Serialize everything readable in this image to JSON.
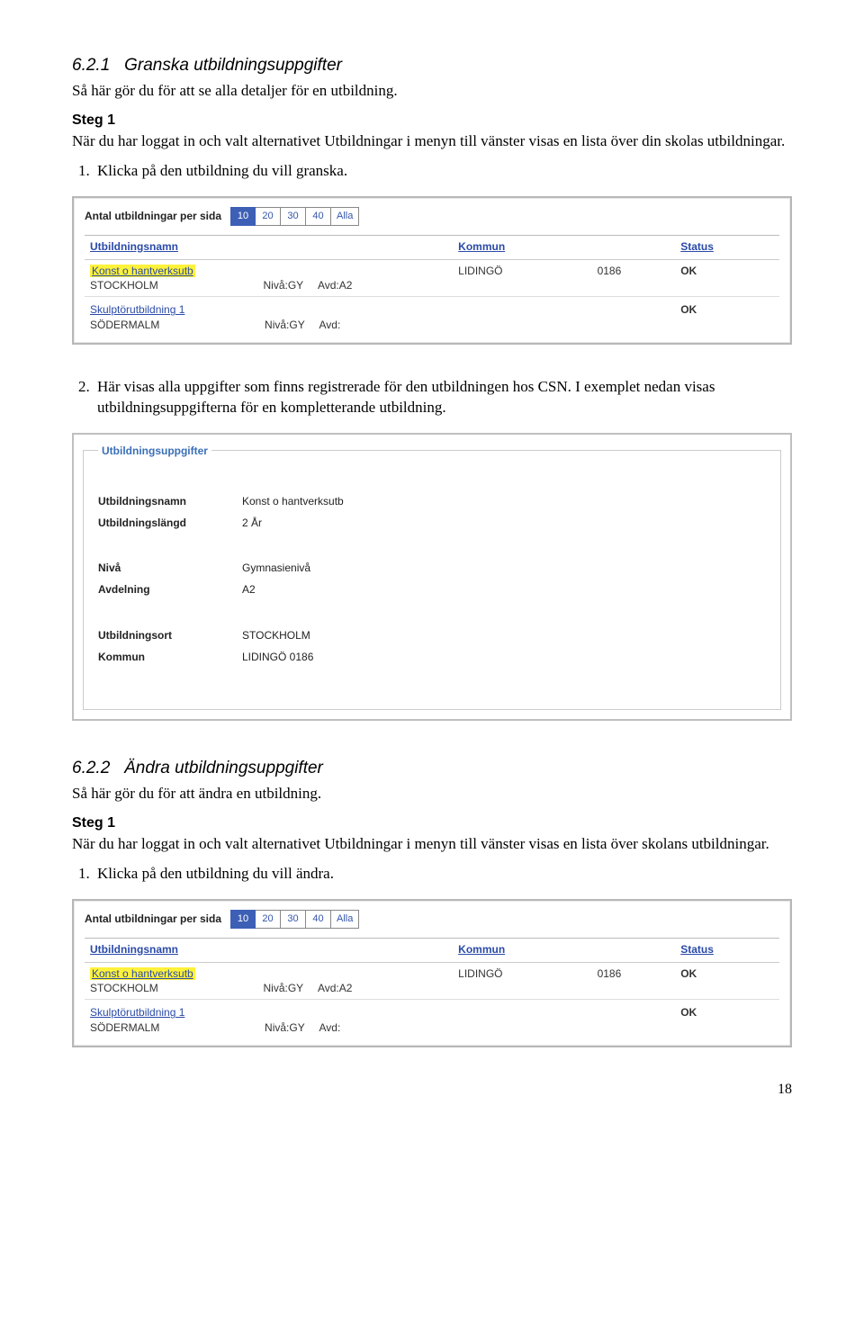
{
  "section1": {
    "number": "6.2.1",
    "title": "Granska utbildningsuppgifter",
    "intro": "Så här gör du för att se alla detaljer för en utbildning.",
    "step_label": "Steg 1",
    "step_text": "När du har loggat in och valt alternativet Utbildningar i menyn till vänster visas en lista över din skolas utbildningar.",
    "bullet1": "Klicka på den utbildning du vill granska."
  },
  "pager": {
    "label": "Antal utbildningar per sida",
    "options": [
      "10",
      "20",
      "30",
      "40",
      "Alla"
    ]
  },
  "table": {
    "headers": {
      "name": "Utbildningsnamn",
      "kommun": "Kommun",
      "status": "Status"
    },
    "row1": {
      "name": "Konst o hantverksutb",
      "place": "STOCKHOLM",
      "niva_lbl": "Nivå:",
      "niva": "GY",
      "avd_lbl": "Avd:",
      "avd": "A2",
      "kommun": "LIDINGÖ",
      "kommun_code": "0186",
      "status": "OK"
    },
    "row2": {
      "name": "Skulptörutbildning 1",
      "place": "SÖDERMALM",
      "niva_lbl": "Nivå:",
      "niva": "GY",
      "avd_lbl": "Avd:",
      "avd": "",
      "status": "OK"
    }
  },
  "between": {
    "bullet2": "Här visas alla uppgifter som finns registrerade för den utbildningen hos CSN. I exemplet nedan visas utbildningsuppgifterna för en kompletterande utbildning."
  },
  "details": {
    "legend": "Utbildningsuppgifter",
    "rows": {
      "namn_lbl": "Utbildningsnamn",
      "namn": "Konst o hantverksutb",
      "langd_lbl": "Utbildningslängd",
      "langd": "2  År",
      "niva_lbl": "Nivå",
      "niva": "Gymnasienivå",
      "avd_lbl": "Avdelning",
      "avd": "A2",
      "ort_lbl": "Utbildningsort",
      "ort": "STOCKHOLM",
      "kommun_lbl": "Kommun",
      "kommun": "LIDINGÖ  0186"
    }
  },
  "section2": {
    "number": "6.2.2",
    "title": "Ändra utbildningsuppgifter",
    "intro": "Så här gör du för att ändra en utbildning.",
    "step_label": "Steg 1",
    "step_text": "När du har loggat in och valt alternativet Utbildningar i menyn till vänster visas en lista över skolans utbildningar.",
    "bullet1": "Klicka på den utbildning du vill ändra."
  },
  "page_number": "18"
}
